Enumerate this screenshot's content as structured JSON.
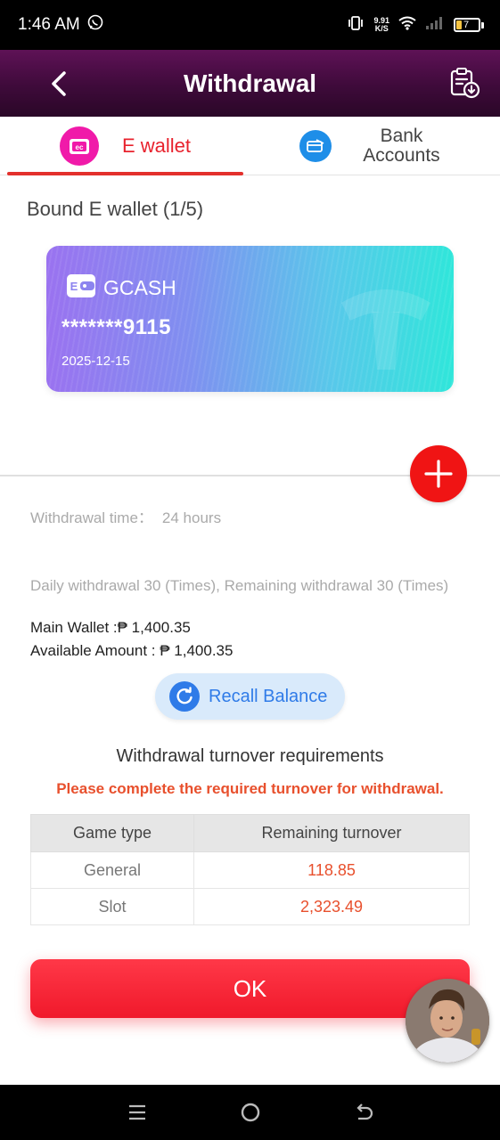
{
  "status_bar": {
    "time": "1:46 AM",
    "speed_value": "9.91",
    "speed_unit": "K/S",
    "battery_level": "7"
  },
  "header": {
    "title": "Withdrawal"
  },
  "tabs": [
    {
      "label": "E wallet",
      "active": true,
      "icon": "wallet-icon",
      "icon_color": "#f01aa9"
    },
    {
      "label": "Bank Accounts",
      "active": false,
      "icon": "bank-card-icon",
      "icon_color": "#1e8ee8"
    }
  ],
  "wallet_section": {
    "title": "Bound E wallet (1/5)",
    "card": {
      "name": "GCASH",
      "number": "*******9115",
      "date": "2025-12-15"
    }
  },
  "info": {
    "withdraw_time_label": "Withdrawal time：",
    "withdraw_time_value": "24 hours",
    "daily_text": "Daily withdrawal 30 (Times), Remaining withdrawal 30 (Times)",
    "main_wallet": "Main Wallet :₱ 1,400.35",
    "available_amount": "Available Amount : ₱ 1,400.35"
  },
  "recall_button": {
    "label": "Recall Balance"
  },
  "turnover": {
    "title": "Withdrawal turnover requirements",
    "warning": "Please complete the required turnover for withdrawal.",
    "headers": [
      "Game type",
      "Remaining turnover"
    ],
    "rows": [
      {
        "type": "General",
        "amount": "118.85"
      },
      {
        "type": "Slot",
        "amount": "2,323.49"
      }
    ]
  },
  "ok_button": {
    "label": "OK"
  },
  "colors": {
    "accent_red": "#e8222d",
    "header_purple": "#4a0d45",
    "recall_blue": "#2f7be8"
  }
}
